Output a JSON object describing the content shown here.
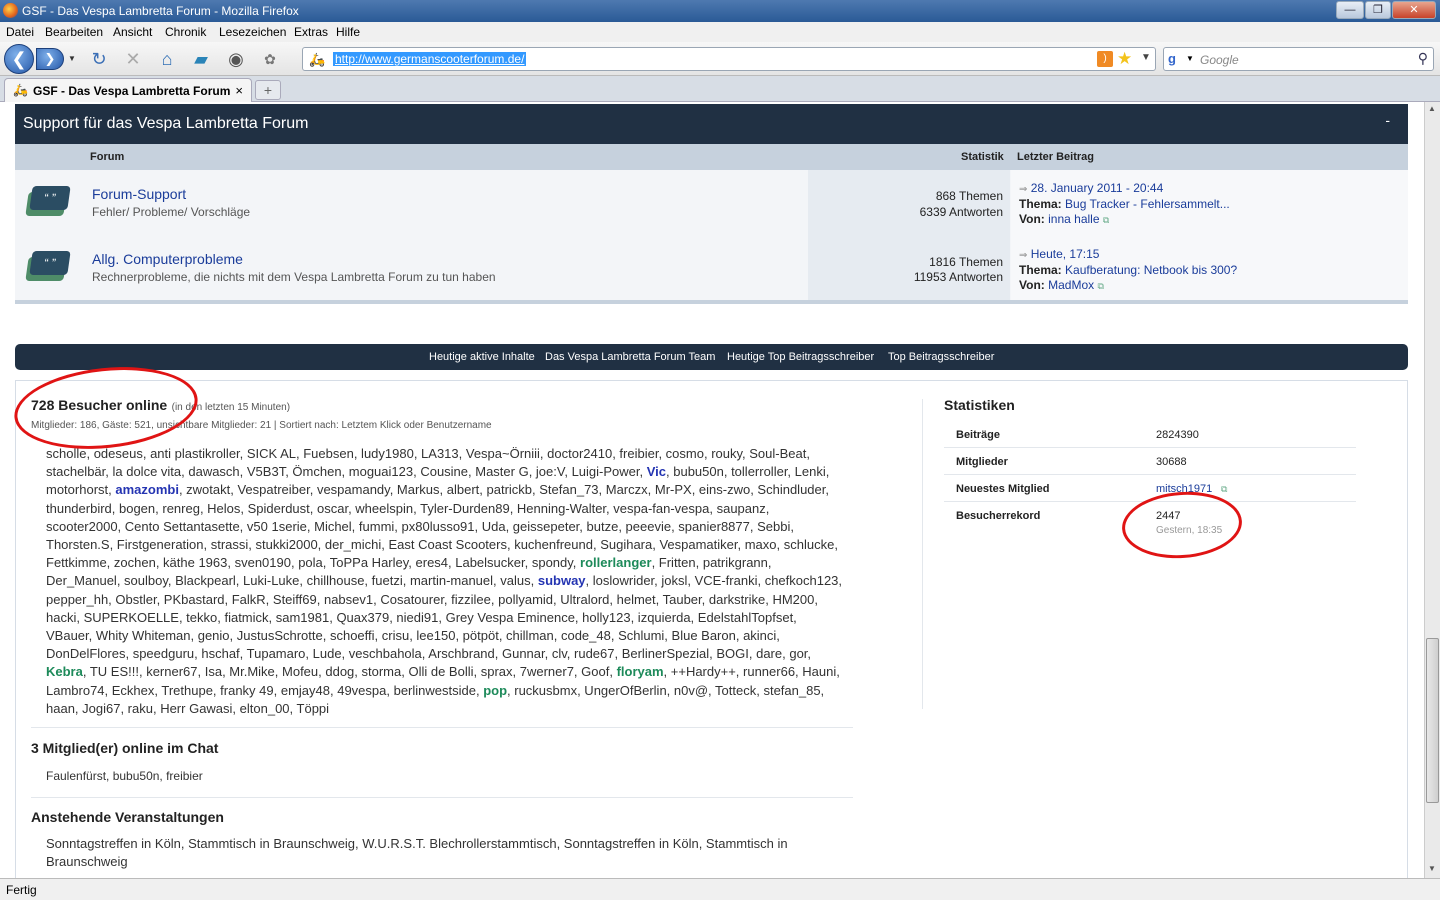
{
  "window": {
    "title": "GSF - Das Vespa Lambretta Forum - Mozilla Firefox"
  },
  "menu": [
    "Datei",
    "Bearbeiten",
    "Ansicht",
    "Chronik",
    "Lesezeichen",
    "Extras",
    "Hilfe"
  ],
  "url": "http://www.germanscooterforum.de/",
  "search": {
    "placeholder": "Google"
  },
  "tab": {
    "label": "GSF - Das Vespa Lambretta Forum",
    "close": "×",
    "new": "+"
  },
  "category": {
    "title": "Support für das Vespa Lambretta Forum",
    "collapse": "-",
    "col_forum": "Forum",
    "col_stats": "Statistik",
    "col_last": "Letzter Beitrag"
  },
  "forums": [
    {
      "name": "Forum-Support",
      "desc": "Fehler/ Probleme/ Vorschläge",
      "topics": "868 Themen",
      "replies": "6339 Antworten",
      "last_date": "28. January 2011 - 20:44",
      "topic_label": "Thema:",
      "topic": "Bug Tracker - Fehlersammelt...",
      "by_label": "Von:",
      "by": "inna halle"
    },
    {
      "name": "Allg. Computerprobleme",
      "desc": "Rechnerprobleme, die nichts mit dem Vespa Lambretta Forum zu tun haben",
      "topics": "1816 Themen",
      "replies": "11953 Antworten",
      "last_date": "Heute, 17:15",
      "topic_label": "Thema:",
      "topic": "Kaufberatung: Netbook bis 300?",
      "by_label": "Von:",
      "by": "MadMox"
    }
  ],
  "nav_strip": [
    "Heutige aktive Inhalte",
    "Das Vespa Lambretta Forum Team",
    "Heutige Top Beitragsschreiber",
    "Top Beitragsschreiber"
  ],
  "online": {
    "title": "728 Besucher online",
    "subtitle": "(in den letzten 15 Minuten)",
    "details": "Mitglieder: 186, Gäste: 521, unsichtbare Mitglieder: 21 | Sortiert nach: Letztem Klick oder Benutzername"
  },
  "chat": {
    "title": "3 Mitglied(er) online im Chat",
    "users": "Faulenfürst, bubu50n, freibier"
  },
  "events": {
    "title": "Anstehende Veranstaltungen",
    "list": "Sonntagstreffen in Köln, Stammtisch in Braunschweig, W.U.R.S.T. Blechrollerstammtisch, Sonntagstreffen in Köln, Stammtisch in Braunschweig"
  },
  "stats": {
    "title": "Statistiken",
    "rows": [
      {
        "k": "Beiträge",
        "v": "2824390"
      },
      {
        "k": "Mitglieder",
        "v": "30688"
      },
      {
        "k": "Neuestes Mitglied",
        "v": "mitsch1971"
      },
      {
        "k": "Besucherrekord",
        "v": "2447",
        "sub": "Gestern, 18:35"
      }
    ]
  },
  "status": "Fertig",
  "colors": {
    "accent": "#203043",
    "highlight": "#e01414"
  }
}
